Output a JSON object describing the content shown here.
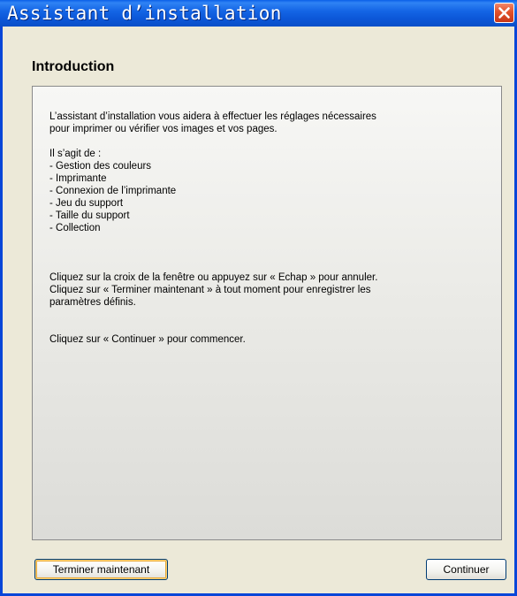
{
  "window": {
    "title": "Assistant d’installation"
  },
  "page": {
    "heading": "Introduction"
  },
  "content": {
    "intro_line1": "L’assistant d’installation vous aidera à effectuer les réglages nécessaires",
    "intro_line2": "pour imprimer ou vérifier vos images et vos pages.",
    "list_title": "Il s’agit de :",
    "list_items": [
      "- Gestion des couleurs",
      "- Imprimante",
      "- Connexion de l’imprimante",
      "- Jeu du support",
      "- Taille du support",
      "- Collection"
    ],
    "cancel_line1": "Cliquez sur la croix de la fenêtre ou appuyez sur « Echap » pour annuler.",
    "cancel_line2": "Cliquez sur « Terminer maintenant » à tout moment pour enregistrer les",
    "cancel_line3": "paramètres définis.",
    "start_line": "Cliquez sur « Continuer » pour commencer."
  },
  "buttons": {
    "finish_label": "Terminer maintenant",
    "continue_label": "Continuer"
  },
  "icons": {
    "close": "close-icon"
  },
  "colors": {
    "titlebar": "#0a5fe8",
    "close_button": "#e2512a",
    "window_background": "#ece9d8"
  }
}
